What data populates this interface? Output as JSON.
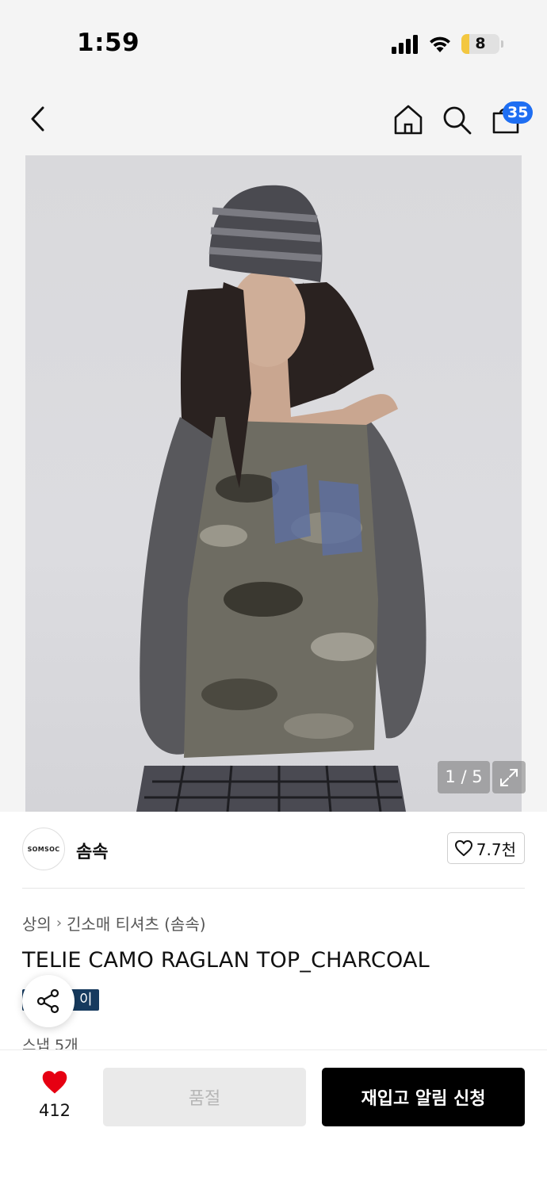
{
  "status_bar": {
    "time": "1:59",
    "battery_level": "8",
    "battery_fraction": 0.08
  },
  "header": {
    "icons": [
      "back-icon",
      "home-icon",
      "search-icon",
      "cart-icon"
    ],
    "cart_count": "35",
    "badge_color": "#1e6ef2"
  },
  "gallery": {
    "counter": "1 / 5",
    "current": 1,
    "total": 5
  },
  "brand": {
    "logo_text": "SOMSOC",
    "name": "솜속",
    "likes": "7.7천"
  },
  "product": {
    "breadcrumb": [
      "상의",
      "긴소매 티셔츠 (솜속)"
    ],
    "title": "TELIE CAMO RAGLAN TOP_CHARCOAL",
    "tag_visible": "이",
    "snap_count": "스냅 5개"
  },
  "bottom_bar": {
    "wish_count": "412",
    "soldout_label": "품절",
    "restock_label": "재입고 알림 신청",
    "heart_color": "#e60012"
  }
}
